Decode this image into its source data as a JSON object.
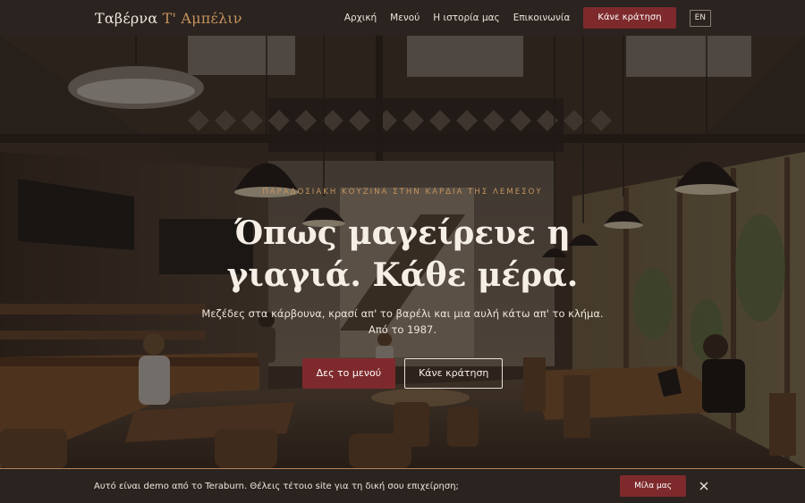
{
  "brand": {
    "name_main": "Ταβέρνα ",
    "name_accent": "Τ' Αμπέλιν"
  },
  "nav": {
    "links": [
      "Αρχική",
      "Μενού",
      "Η ιστορία μας",
      "Επικοινωνία"
    ],
    "cta": "Κάνε κράτηση",
    "lang": "EN"
  },
  "hero": {
    "eyebrow": "ΠΑΡΑΔΟΣΙΑΚΗ ΚΟΥΖΙΝΑ ΣΤΗΝ ΚΑΡΔΙΑ ΤΗΣ ΛΕΜΕΣΟΥ",
    "headline_line1": "Όπως μαγείρευε η",
    "headline_line2": "γιαγιά. Κάθε μέρα.",
    "sub_line1": "Μεζέδες στα κάρβουνα, κρασί απ' το βαρέλι και μια αυλή κάτω απ' το κλήμα.",
    "sub_line2": "Από το 1987.",
    "primary_button": "Δες το μενού",
    "secondary_button": "Κάνε κράτηση"
  },
  "banner": {
    "text": "Αυτό είναι demo από το Teraburn. Θέλεις τέτοιο site για τη δική σου επιχείρηση;",
    "button": "Μίλα μας"
  },
  "colors": {
    "accent": "#c6935c",
    "brand_red": "#7e2a2c",
    "dark_bg": "#2a2320"
  },
  "icons": {
    "close": "close-icon"
  }
}
